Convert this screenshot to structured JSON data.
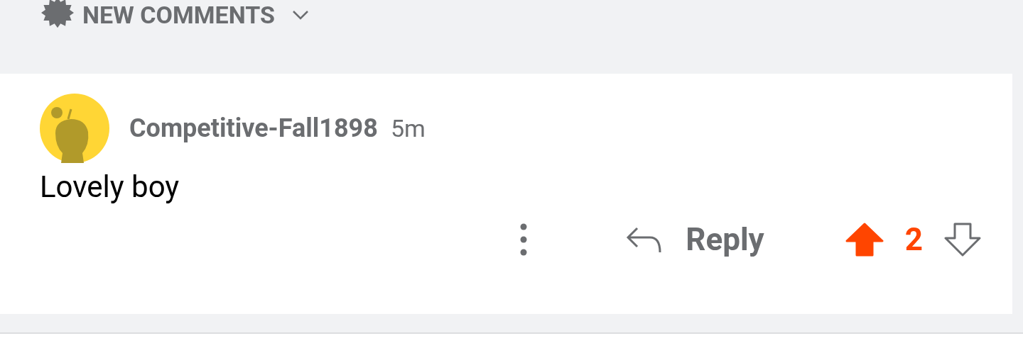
{
  "sort": {
    "label": "NEW COMMENTS"
  },
  "comment": {
    "author": "Competitive-Fall1898",
    "time": "5m",
    "body": "Lovely boy",
    "score": "2",
    "upvoted": true,
    "downvoted": false
  },
  "actions": {
    "reply": "Reply"
  }
}
